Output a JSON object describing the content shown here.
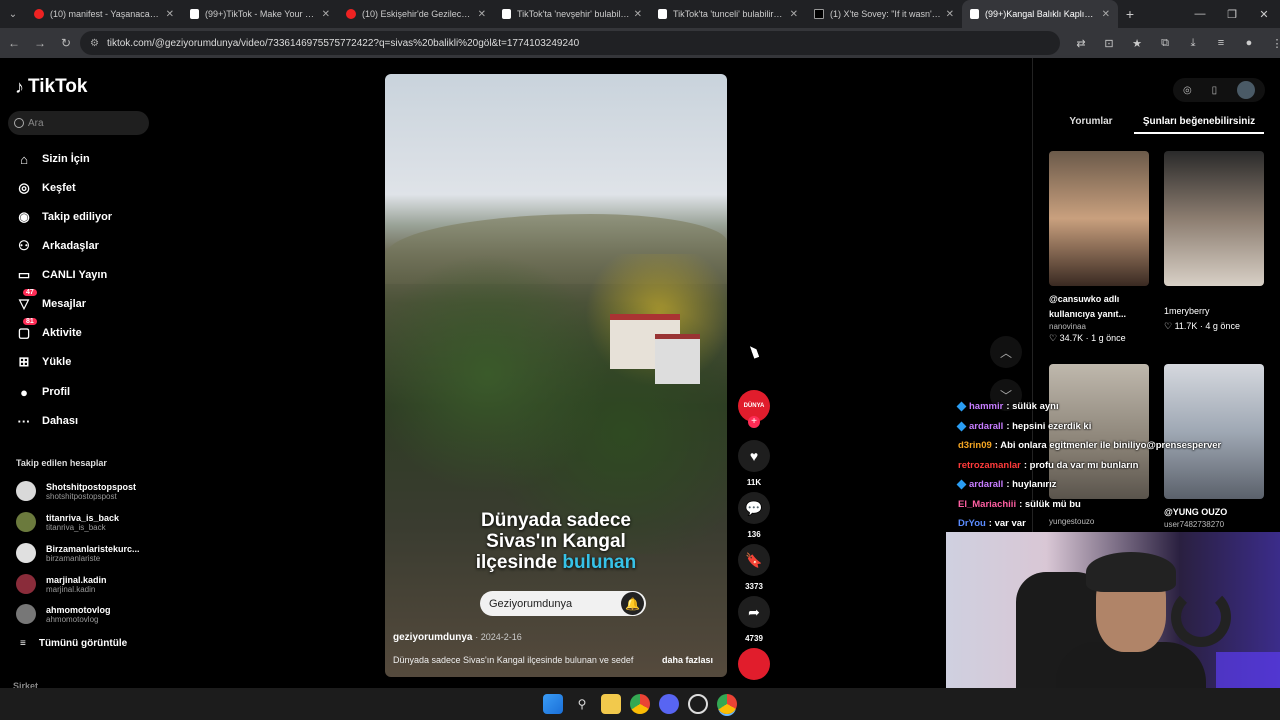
{
  "browser": {
    "tabs": [
      {
        "label": "(10) manifest - Yaşanacaksa | O",
        "type": "yt"
      },
      {
        "label": "(99+)TikTok - Make Your Day",
        "type": "tt"
      },
      {
        "label": "(10) Eskişehir'de Gezilecek Yerl",
        "type": "yt"
      },
      {
        "label": "TikTok'ta 'nevşehir' bulabilirsin",
        "type": "tt"
      },
      {
        "label": "TikTok'ta 'tunceli' bulabilirsiniz",
        "type": "tt"
      },
      {
        "label": "(1) X'te Sovey: \"If it wasn't for w",
        "type": "x"
      },
      {
        "label": "(99+)Kangal Balıklı Kaplıcası - S",
        "type": "tt"
      }
    ],
    "url": "tiktok.com/@geziyorumdunya/video/7336146975575772422?q=sivas%20balikli%20göl&t=1774103249240"
  },
  "sidebar": {
    "logo": "TikTok",
    "search_placeholder": "Ara",
    "nav": [
      {
        "label": "Sizin İçin",
        "icon": "home-icon",
        "glyph": "⌂",
        "badge": null
      },
      {
        "label": "Keşfet",
        "icon": "compass-icon",
        "glyph": "◎",
        "badge": null
      },
      {
        "label": "Takip ediliyor",
        "icon": "following-icon",
        "glyph": "◉",
        "badge": null
      },
      {
        "label": "Arkadaşlar",
        "icon": "friends-icon",
        "glyph": "👥",
        "badge": null
      },
      {
        "label": "CANLI Yayın",
        "icon": "live-icon",
        "glyph": "▭",
        "badge": null
      },
      {
        "label": "Mesajlar",
        "icon": "messages-icon",
        "glyph": "▽",
        "badge": "47"
      },
      {
        "label": "Aktivite",
        "icon": "activity-icon",
        "glyph": "▢",
        "badge": "81"
      },
      {
        "label": "Yükle",
        "icon": "upload-icon",
        "glyph": "⊞",
        "badge": null
      },
      {
        "label": "Profil",
        "icon": "profile-icon",
        "glyph": "●",
        "badge": null
      },
      {
        "label": "Dahası",
        "icon": "more-icon",
        "glyph": "···",
        "badge": null
      }
    ],
    "following_title": "Takip edilen hesaplar",
    "following": [
      {
        "name": "Shotshitpostopspost",
        "handle": "shotshitpostopspost"
      },
      {
        "name": "titanriva_is_back",
        "handle": "titanriva_is_back"
      },
      {
        "name": "Birzamanlaristekurc...",
        "handle": "birzamanlariste"
      },
      {
        "name": "marjinal.kadin",
        "handle": "marjinal.kadin"
      },
      {
        "name": "ahmomotovlog",
        "handle": "ahmomotovlog"
      }
    ],
    "see_all": "Tümünü görüntüle",
    "company": "Şirket"
  },
  "video": {
    "caption_line1": "Dünyada sadece",
    "caption_line2": "Sivas'ın Kangal",
    "caption_line3a": "ilçesinde",
    "caption_line3b": "bulunan",
    "follow_pill": "Geziyorumdunya",
    "author": "geziyorumdunya",
    "date": "· 2024-2-16",
    "description": "Dünyada sadece Sivas'ın Kangal ilçesinde bulunan ve sedef",
    "more": "daha fazlası"
  },
  "actions": {
    "creator_label": "DÜNYA",
    "likes": "11K",
    "comments": "136",
    "saves": "3373",
    "shares": "4739"
  },
  "right_panel": {
    "tab_comments": "Yorumlar",
    "tab_liked": "Şunları beğenebilirsiniz",
    "cards": [
      {
        "title1": "@cansuwko adlı",
        "title2": "kullanıcıya yanıt...",
        "author": "nanovinaa",
        "stats": "♡ 34.7K · 1 g önce"
      },
      {
        "title1": "1meryberry",
        "title2": "",
        "author": "",
        "stats": "♡ 11.7K · 4 g önce"
      },
      {
        "title1": "",
        "title2": "",
        "author": "yungestouzo",
        "stats": ""
      },
      {
        "title1": "@YUNG OUZO",
        "title2": "",
        "author": "user7482738270",
        "stats": ""
      }
    ]
  },
  "chat": [
    {
      "user": "hammir",
      "msg": ": sülük aynı",
      "color": "#c77dff"
    },
    {
      "user": "ardarall",
      "msg": ": hepsini ezerdik ki",
      "color": "#c77dff"
    },
    {
      "user": "d3rin09",
      "msg": ": Abi onlara egitmenler ile biniliyo@prensesperver",
      "color": "#f5a623"
    },
    {
      "user": "retrozamanlar",
      "msg": ": profu da var mı bunların",
      "color": "#ff3b3b"
    },
    {
      "user": "ardarall",
      "msg": ": huylanırız",
      "color": "#c77dff"
    },
    {
      "user": "El_Mariachiii",
      "msg": ": sülük mü bu",
      "color": "#ff5fa2"
    },
    {
      "user": "DrYou",
      "msg": ": var var",
      "color": "#5b8cff"
    }
  ]
}
